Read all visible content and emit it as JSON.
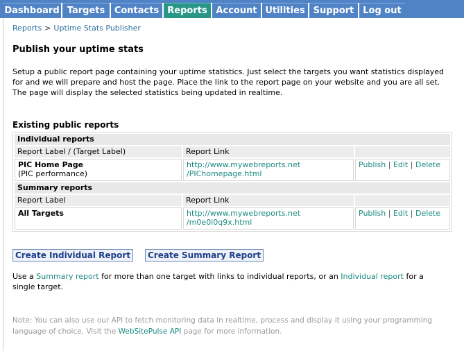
{
  "nav": {
    "items": [
      {
        "label": "Dashboard"
      },
      {
        "label": "Targets"
      },
      {
        "label": "Contacts"
      },
      {
        "label": "Reports",
        "active": true
      },
      {
        "label": "Account"
      },
      {
        "label": "Utilities"
      },
      {
        "label": "Support"
      },
      {
        "label": "Log out"
      }
    ],
    "colors": {
      "bar": "#4f83c6",
      "active": "#2a9688"
    }
  },
  "breadcrumb": {
    "root": "Reports",
    "sep": ">",
    "current": "Uptime Stats Publisher"
  },
  "page": {
    "title": "Publish your uptime stats",
    "intro": "Setup a public report page containing your uptime statistics. Just select the targets you want statistics displayed for and we will prepare and host the page. Place the link to the report page on your website and you are all set. The page will display the selected statistics being updated in realtime."
  },
  "existing": {
    "heading": "Existing public reports",
    "individual": {
      "section": "Individual reports",
      "col_label": "Report Label / (Target Label)",
      "col_link": "Report Link",
      "rows": [
        {
          "label": "PIC Home Page",
          "target": "(PIC performance)",
          "link_line1": "http://www.mywebreports.net",
          "link_line2": "/PIChomepage.html",
          "publish": "Publish",
          "edit": "Edit",
          "delete": "Delete",
          "pipe": "|"
        }
      ]
    },
    "summary": {
      "section": "Summary reports",
      "col_label": "Report Label",
      "col_link": "Report Link",
      "rows": [
        {
          "label": "All Targets",
          "link_line1": "http://www.mywebreports.net",
          "link_line2": "/m0e0i0q9x.html",
          "publish": "Publish",
          "edit": "Edit",
          "delete": "Delete",
          "pipe": "|"
        }
      ]
    }
  },
  "buttons": {
    "create_individual": "Create Individual Report",
    "create_summary": "Create Summary Report"
  },
  "usage": {
    "pre": "Use a",
    "summary_link": "Summary report",
    "mid": "for more than one target with links to individual reports, or an",
    "individual_link": "Individual report",
    "post": "for a single target."
  },
  "note": {
    "pre": "Note: You can also use our API to fetch monitoring data in realtime, process and display it using your programming language of choice. Visit the",
    "api_link": "WebSitePulse API",
    "post": "page for more information."
  }
}
